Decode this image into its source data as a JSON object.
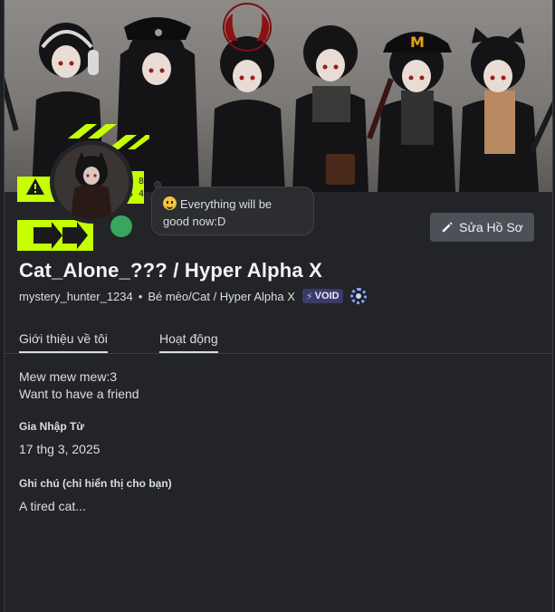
{
  "status": {
    "text_line1": "Everything will be",
    "text_line2": "good now:D",
    "emoji": "grinning-face-emoji"
  },
  "actions": {
    "edit_profile_label": "Sửa Hồ Sơ"
  },
  "profile": {
    "display_name": "Cat_Alone_??? / Hyper Alpha X",
    "username": "mystery_hunter_1234",
    "separator": "•",
    "pronouns": "Bé mèo/Cat / Hyper Alpha X",
    "badge_label": "VOID",
    "badge_icon": "⚡",
    "avatar_deco_text_1": "H 8",
    "avatar_deco_text_2": "S 4"
  },
  "tabs": [
    {
      "label": "Giới thiệu về tôi"
    },
    {
      "label": "Hoạt động"
    }
  ],
  "about": {
    "bio_line1": "Mew mew mew:3",
    "bio_line2": "Want to have a friend",
    "member_since_title": "Gia Nhập Từ",
    "member_since_value": "17 thg 3, 2025",
    "note_title": "Ghi chú (chỉ hiển thị cho bạn)",
    "note_value": "A tired cat..."
  },
  "colors": {
    "background": "#232428",
    "accent_lime": "#c6ff00",
    "status_online": "#3aa55c",
    "button": "#4e5058"
  }
}
